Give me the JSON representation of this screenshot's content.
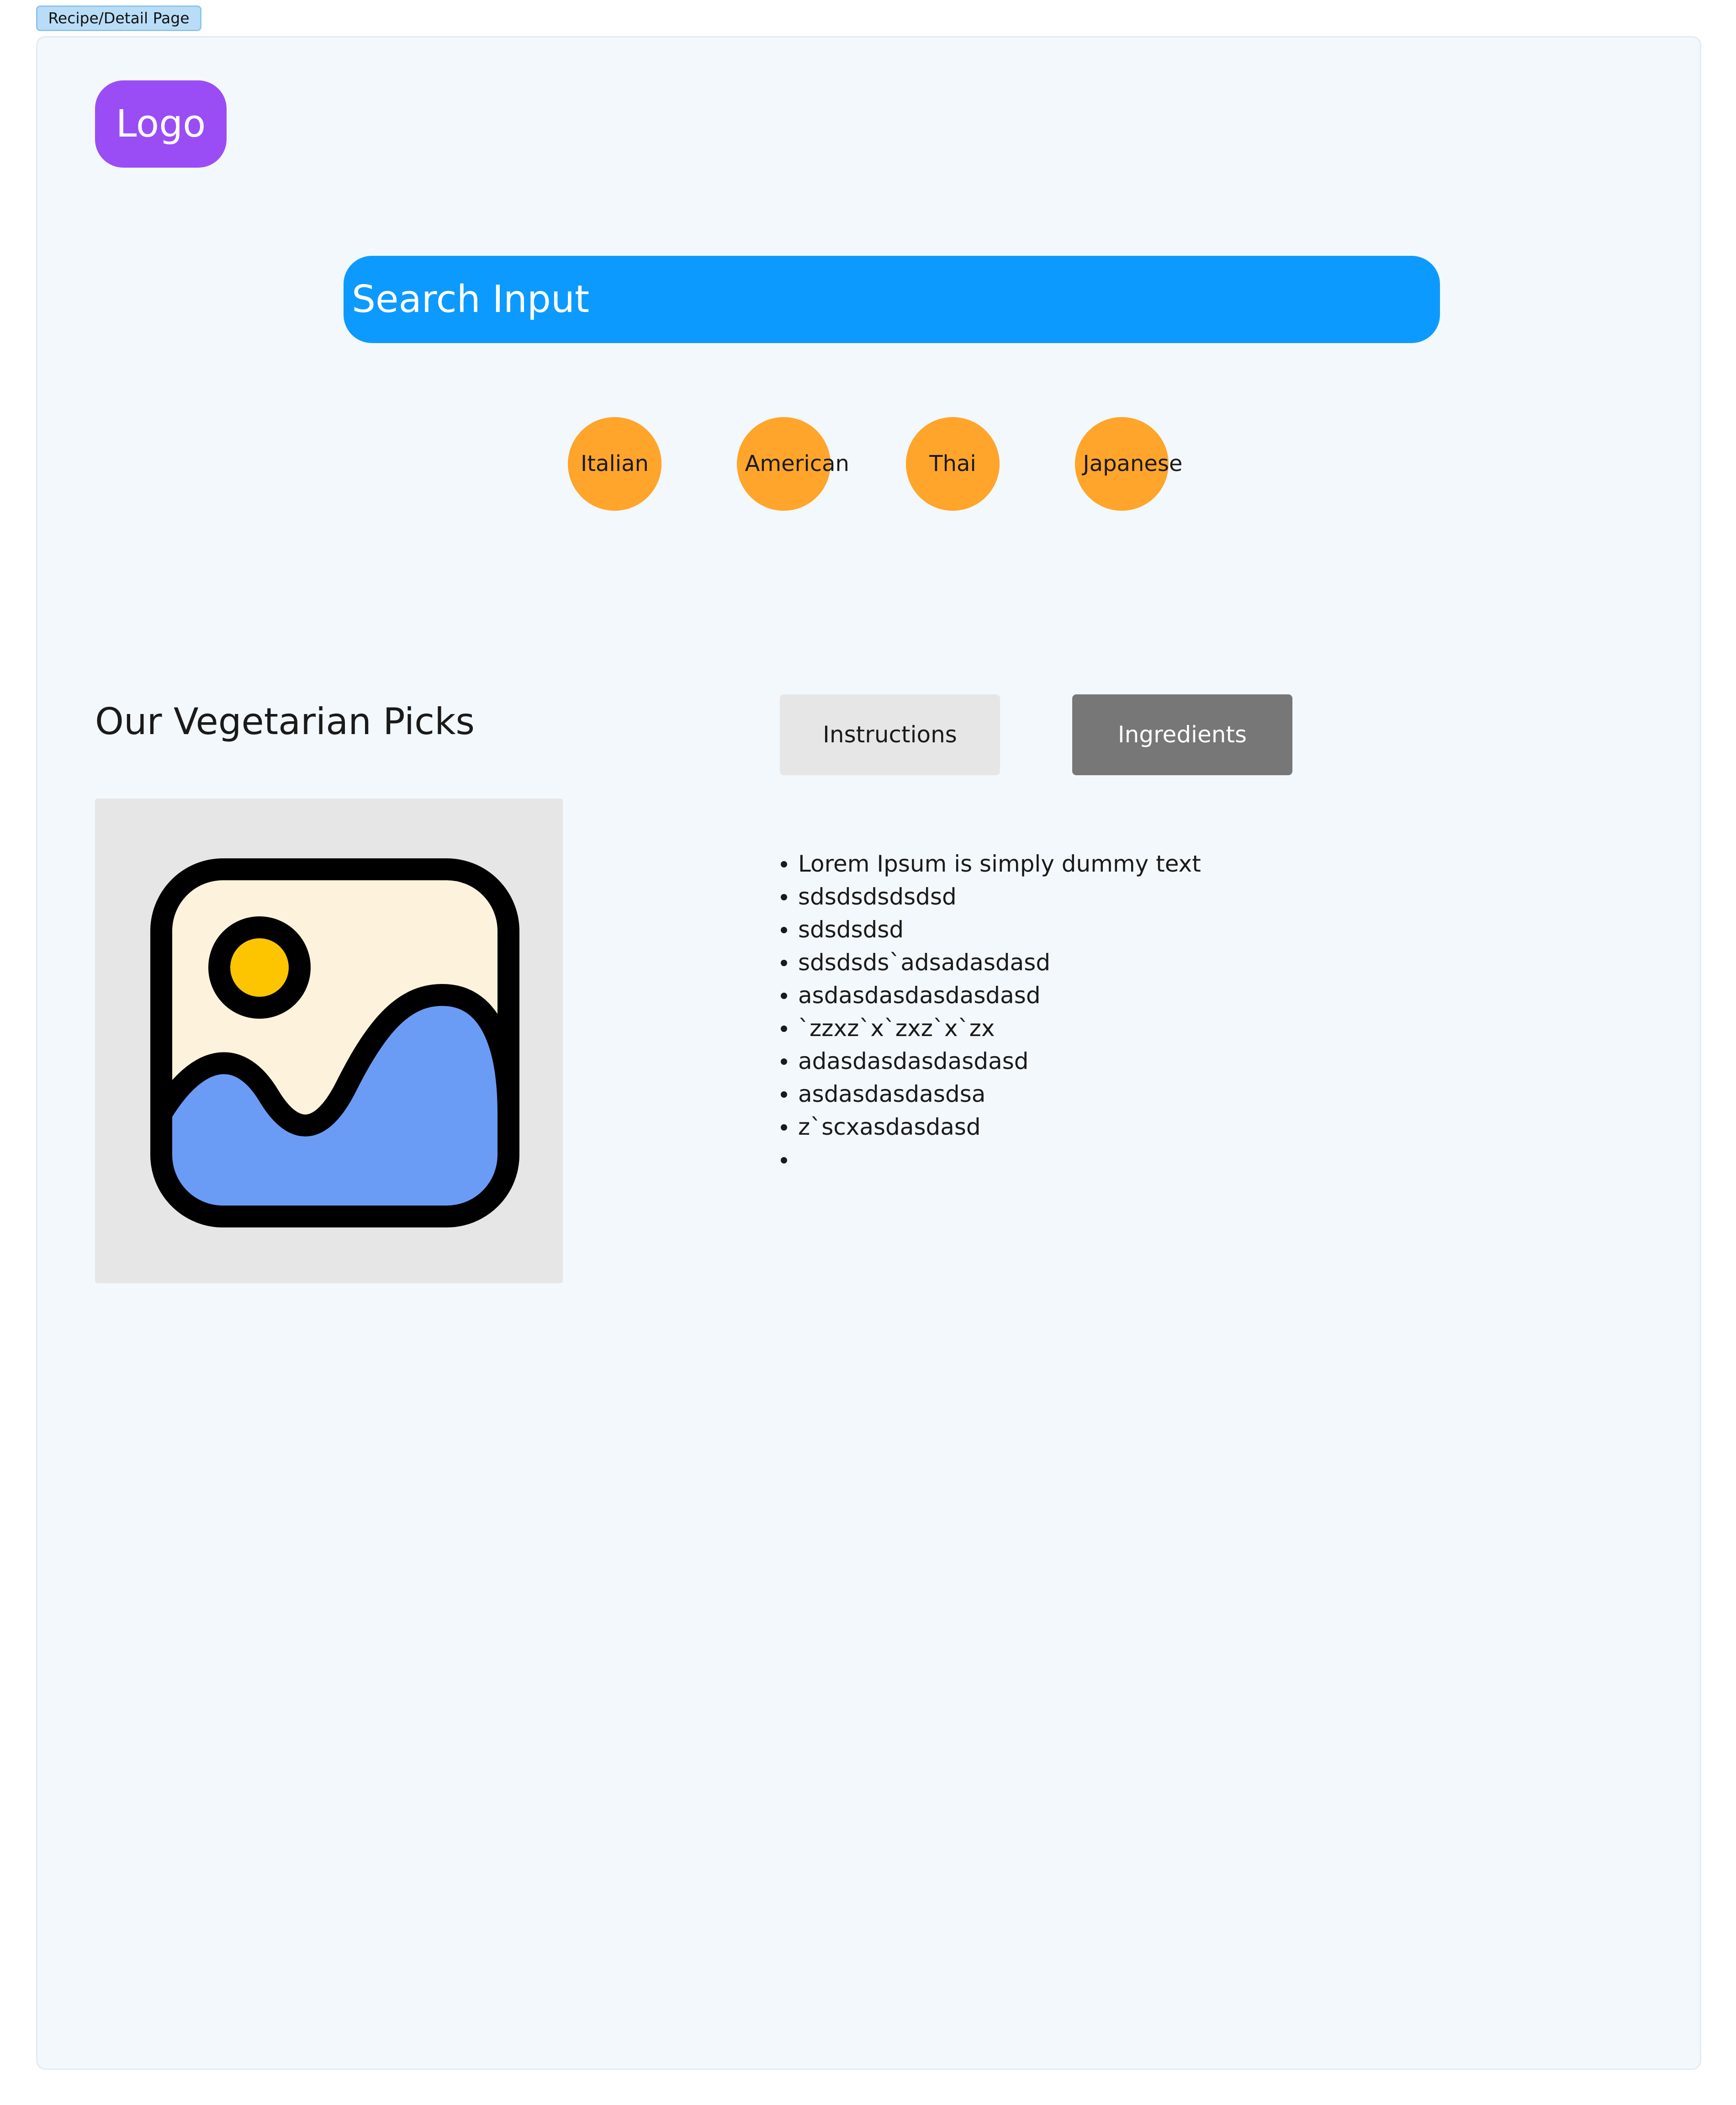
{
  "frame": {
    "label": "Recipe/Detail Page",
    "background": "#f3f8fc"
  },
  "header": {
    "logo_label": "Logo",
    "logo_color": "#9b4df5"
  },
  "search": {
    "placeholder": "Search Input",
    "color": "#0d9aff"
  },
  "cuisines": [
    {
      "label": "Italian"
    },
    {
      "label": "American"
    },
    {
      "label": "Thai"
    },
    {
      "label": "Japanese"
    }
  ],
  "cuisine_chip_color": "#ffa52b",
  "section": {
    "title": "Our Vegetarian Picks",
    "image_icon": "image-placeholder-icon"
  },
  "tabs": [
    {
      "label": "Instructions",
      "active": false
    },
    {
      "label": "Ingredients",
      "active": true
    }
  ],
  "ingredients": [
    "Lorem Ipsum is simply dummy text",
    "sdsdsdsdsdsd",
    "sdsdsdsd",
    "sdsdsds`adsadasdasd",
    "asdasdasdasdasdasd",
    "`zzxz`x`zxz`x`zx",
    "adasdasdasdasdasd",
    "asdasdasdasdsa",
    "z`scxasdasdasd",
    ""
  ]
}
